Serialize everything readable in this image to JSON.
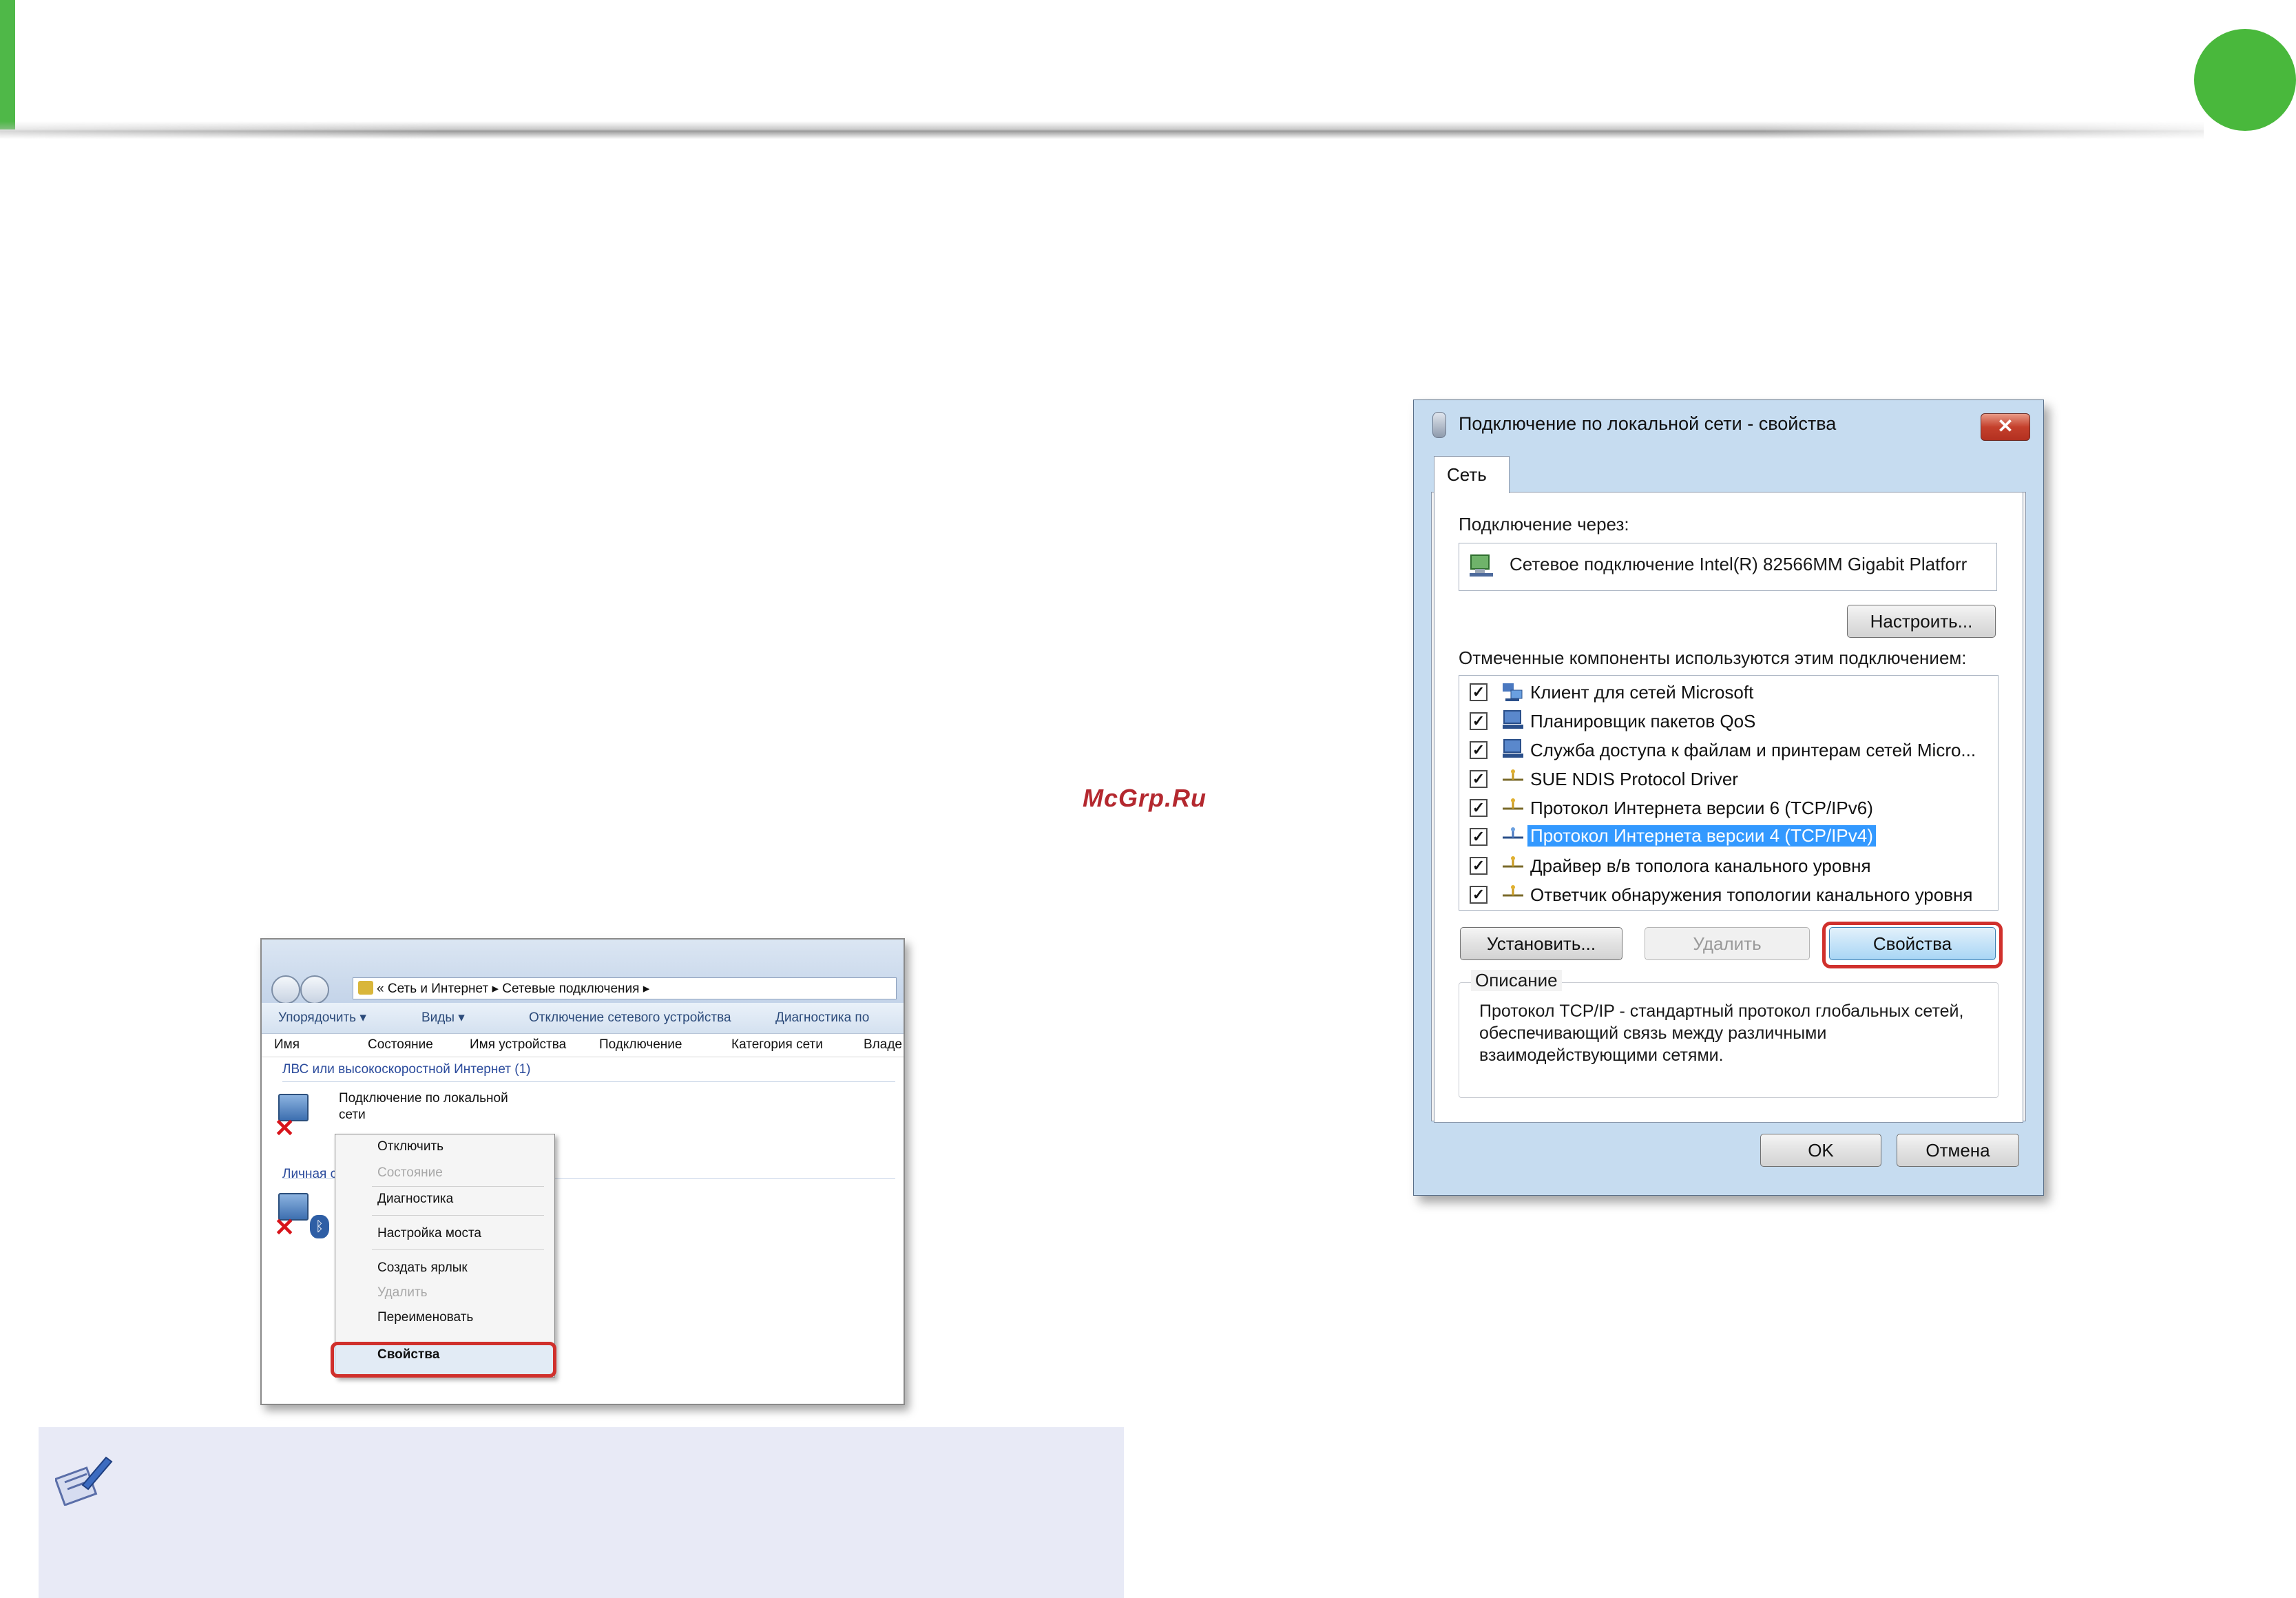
{
  "page": {
    "watermark": "McGrp.Ru",
    "badge_color": "#49b83c",
    "accent_color": "#4fb848",
    "highlight_color": "#d0302c"
  },
  "explorer": {
    "address": "« Сеть и Интернет ▸ Сетевые подключения ▸",
    "toolbar": {
      "organize": "Упорядочить ▾",
      "views": "Виды ▾",
      "disable": "Отключение сетевого устройства",
      "diagnose": "Диагностика по"
    },
    "columns": [
      "Имя",
      "Состояние",
      "Имя устройства",
      "Подключение",
      "Категория сети",
      "Владе"
    ],
    "group1": "ЛВС или высокоскоростной Интернет (1)",
    "connection_name_line1": "Подключение по локальной",
    "connection_name_line2": "сети",
    "group2": "Личная с",
    "context_menu": {
      "disconnect": "Отключить",
      "status": "Состояние",
      "diagnose": "Диагностика",
      "bridge": "Настройка моста",
      "shortcut": "Создать ярлык",
      "delete": "Удалить",
      "rename": "Переименовать",
      "properties": "Свойства"
    }
  },
  "dialog": {
    "title": "Подключение по локальной сети - свойства",
    "close": "✕",
    "tab": "Сеть",
    "connect_using_label": "Подключение через:",
    "adapter": "Сетевое подключение Intel(R) 82566MM Gigabit Platforr",
    "configure_button": "Настроить...",
    "components_label": "Отмеченные компоненты используются этим подключением:",
    "components": [
      {
        "label": "Клиент для сетей Microsoft",
        "checked": true,
        "icon": "network-client-icon"
      },
      {
        "label": "Планировщик пакетов QoS",
        "checked": true,
        "icon": "computer-service-icon"
      },
      {
        "label": "Служба доступа к файлам и принтерам сетей Micro...",
        "checked": true,
        "icon": "computer-service-icon"
      },
      {
        "label": "SUE NDIS Protocol Driver",
        "checked": true,
        "icon": "protocol-icon"
      },
      {
        "label": "Протокол Интернета версии 6 (TCP/IPv6)",
        "checked": true,
        "icon": "protocol-icon"
      },
      {
        "label": "Протокол Интернета версии 4 (TCP/IPv4)",
        "checked": true,
        "icon": "protocol-icon",
        "selected": true
      },
      {
        "label": "Драйвер в/в тополога канального уровня",
        "checked": true,
        "icon": "protocol-icon"
      },
      {
        "label": "Ответчик обнаружения топологии канального уровня",
        "checked": true,
        "icon": "protocol-icon"
      }
    ],
    "install_button": "Установить...",
    "uninstall_button": "Удалить",
    "properties_button": "Свойства",
    "description_label": "Описание",
    "description_text": "Протокол TCP/IP - стандартный протокол глобальных сетей, обеспечивающий связь между различными взаимодействующими сетями.",
    "ok_button": "OK",
    "cancel_button": "Отмена"
  }
}
